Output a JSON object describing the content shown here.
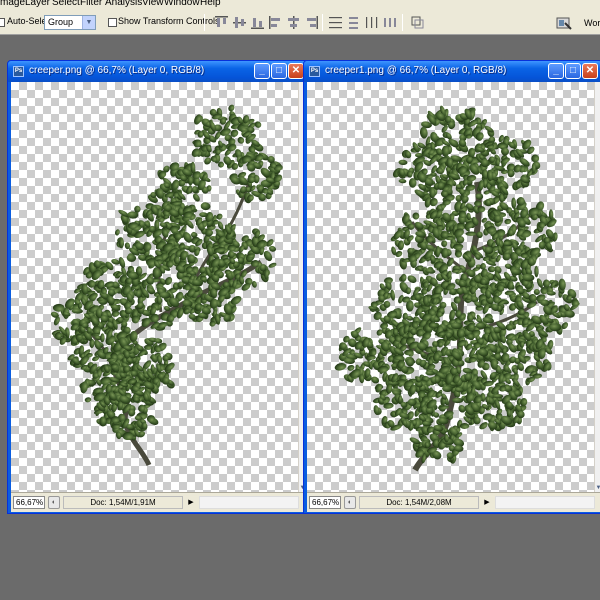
{
  "menu": [
    "mage",
    "Layer",
    "Select",
    "Filter",
    "Analysis",
    "View",
    "Window",
    "Help"
  ],
  "options": {
    "auto_select_label": "Auto-Select:",
    "auto_select_value": "Group",
    "transform_label": "Show Transform Controls",
    "workspace_label": "Work"
  },
  "windows": [
    {
      "title": "creeper.png @ 66,7% (Layer 0, RGB/8)",
      "app_icon": "Ps",
      "zoom": "66,67%",
      "doc_info": "Doc: 1,54M/1,91M"
    },
    {
      "title": "creeper1.png @ 66,7% (Layer 0, RGB/8)",
      "app_icon": "Ps",
      "zoom": "66,67%",
      "doc_info": "Doc: 1,54M/2,08M"
    }
  ],
  "colors": {
    "titlebar_blue": "#0554d8",
    "workspace_gray": "#6b6b6b",
    "foliage_dark": "#2f4a22",
    "foliage_light": "#6f8a4e"
  }
}
